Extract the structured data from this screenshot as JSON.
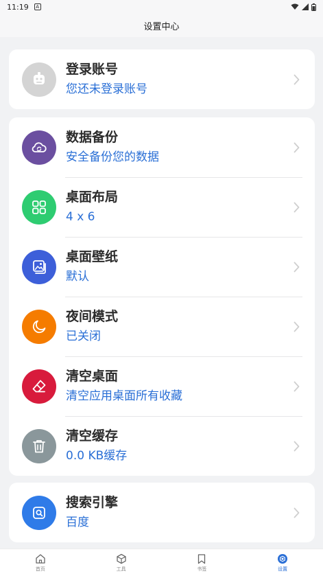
{
  "status": {
    "time": "11:19"
  },
  "header": {
    "title": "设置中心"
  },
  "login": {
    "title": "登录账号",
    "subtitle": "您还未登录账号"
  },
  "settings": {
    "backup": {
      "title": "数据备份",
      "subtitle": "安全备份您的数据",
      "icon": "cloud-sync-icon",
      "color": "#6b4fa0"
    },
    "layout": {
      "title": "桌面布局",
      "subtitle": "4 x 6",
      "icon": "grid-icon",
      "color": "#2ecc71"
    },
    "wallpaper": {
      "title": "桌面壁纸",
      "subtitle": "默认",
      "icon": "image-icon",
      "color": "#3d5fd9"
    },
    "night": {
      "title": "夜间模式",
      "subtitle": "已关闭",
      "icon": "moon-icon",
      "color": "#f57c00"
    },
    "clear_desktop": {
      "title": "清空桌面",
      "subtitle": "清空应用桌面所有收藏",
      "icon": "eraser-icon",
      "color": "#d81b3c"
    },
    "clear_cache": {
      "title": "清空缓存",
      "subtitle": "0.0 KB缓存",
      "icon": "trash-icon",
      "color": "#8a979b"
    }
  },
  "search_engine": {
    "title": "搜索引擎",
    "subtitle": "百度",
    "icon": "search-icon",
    "color": "#2f7be8"
  },
  "tabs": [
    {
      "label": "首页",
      "icon": "home-icon"
    },
    {
      "label": "工具",
      "icon": "cube-icon"
    },
    {
      "label": "书签",
      "icon": "bookmark-icon"
    },
    {
      "label": "设置",
      "icon": "settings-icon"
    }
  ],
  "accent": "#2a6fd6"
}
